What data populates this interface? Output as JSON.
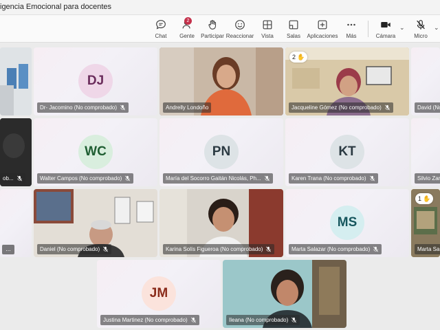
{
  "window": {
    "title": "igencia Emocional para docentes"
  },
  "toolbar": {
    "chat": "Chat",
    "gente": "Gente",
    "gente_count": "2",
    "participar": "Participar",
    "reaccionar": "Reaccionar",
    "vista": "Vista",
    "salas": "Salas",
    "aplicaciones": "Aplicaciones",
    "mas": "Más",
    "camara": "Cámara",
    "micro": "Micro"
  },
  "tiles": {
    "dj": {
      "initials": "DJ",
      "name": "Dr- Jacomino (No comprobado)"
    },
    "andrelly": {
      "name": "Andrelly Londoño"
    },
    "jacqueline": {
      "name": "Jacqueline Gómez (No comprobado)",
      "hand": "2"
    },
    "david": {
      "name": "David (No"
    },
    "left2": {
      "name": "ob..."
    },
    "wc": {
      "initials": "WC",
      "name": "Walter Campos (No comprobado)"
    },
    "pn": {
      "initials": "PN",
      "name": "María del Socorro Gaitán Nicolás, Ph..."
    },
    "kt": {
      "initials": "KT",
      "name": "Karen Trana (No comprobado)"
    },
    "silvio": {
      "name": "Silvio Zar"
    },
    "left3": {
      "more": "..."
    },
    "daniel": {
      "name": "Daniel (No comprobado)"
    },
    "karina": {
      "name": "Karina Solís Figueroa (No comprobado)"
    },
    "ms": {
      "initials": "MS",
      "name": "Marta Salazar (No comprobado)"
    },
    "marta2": {
      "name": "Marta Sal",
      "hand": "1"
    },
    "jm": {
      "initials": "JM",
      "name": "Justina Martinez (No comprobado)"
    },
    "ileana": {
      "name": "Ileana (No comprobado)"
    }
  }
}
